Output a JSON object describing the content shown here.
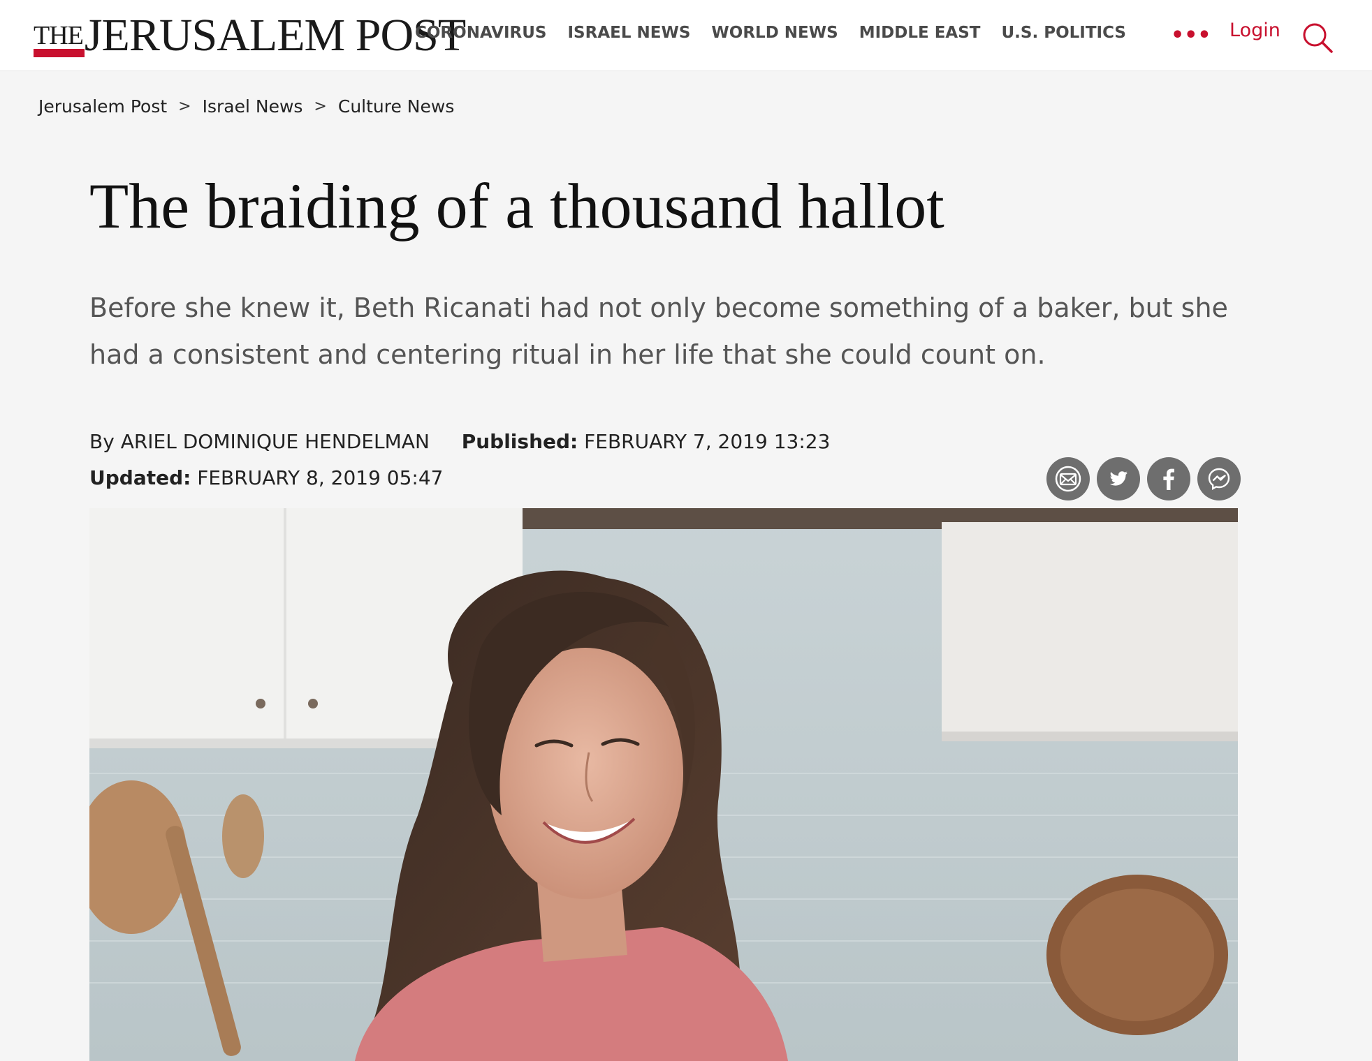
{
  "header": {
    "logo_the": "THE",
    "logo_main": "JERUSALEM POST",
    "nav": [
      "CORONAVIRUS",
      "ISRAEL NEWS",
      "WORLD NEWS",
      "MIDDLE EAST",
      "U.S. POLITICS"
    ],
    "more": "•••",
    "login": "Login",
    "search_icon": "search-icon"
  },
  "breadcrumb": {
    "items": [
      "Jerusalem Post",
      "Israel News",
      "Culture News"
    ],
    "separator": ">"
  },
  "article": {
    "title": "The braiding of a thousand hallot",
    "subtitle": "Before she knew it, Beth Ricanati had not only become something of a baker, but she had a consistent and centering ritual in her life that she could count on.",
    "byline_prefix": "By",
    "author": "ARIEL DOMINIQUE HENDELMAN",
    "published_label": "Published:",
    "published": "FEBRUARY 7, 2019 13:23",
    "updated_label": "Updated:",
    "updated": "FEBRUARY 8, 2019 05:47"
  },
  "share": {
    "icons": [
      "email-icon",
      "twitter-icon",
      "facebook-icon",
      "messenger-icon"
    ]
  },
  "colors": {
    "brand_red": "#c8102e",
    "nav_text": "#4a4a4a",
    "share_gray": "#6e6e6e",
    "page_bg": "#f5f5f5"
  }
}
